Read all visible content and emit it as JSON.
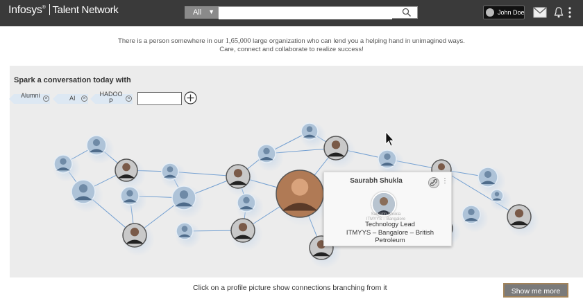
{
  "header": {
    "brand": "Infosys",
    "brand_mark": "®",
    "product": "Talent Network",
    "search_scope": "All",
    "search_value": "",
    "user_name": "John Doe",
    "icons": [
      "search-icon",
      "mail-icon",
      "bell-icon",
      "more-vert-icon"
    ]
  },
  "tagline": {
    "line1_before": "There is a person somewhere in our ",
    "line1_number": "1,65,000",
    "line1_after": " large organization who can lend you a helping hand in unimagined ways.",
    "line2": "Care, connect and collaborate to realize success!"
  },
  "spark": {
    "title": "Spark a conversation today with",
    "tags": [
      "Alumni",
      "AI",
      "HADOOP"
    ],
    "tag_input_value": ""
  },
  "profile_card": {
    "name": "Saurabh Shukla",
    "faded_line1": "Saurabh Shukla",
    "faded_line2": "ITMYYS – Bangalore",
    "role": "Technology Lead",
    "org_line1": "ITMYYS – Bangalore – British",
    "org_line2": "Petroleum"
  },
  "footer": {
    "hint": "Click on a profile picture show connections branching from it",
    "show_more": "Show me more"
  },
  "colors": {
    "topbar": "#3a3a3a",
    "stage": "#ececec",
    "edge": "#4a86c8",
    "show_more_border": "#a2835a"
  }
}
